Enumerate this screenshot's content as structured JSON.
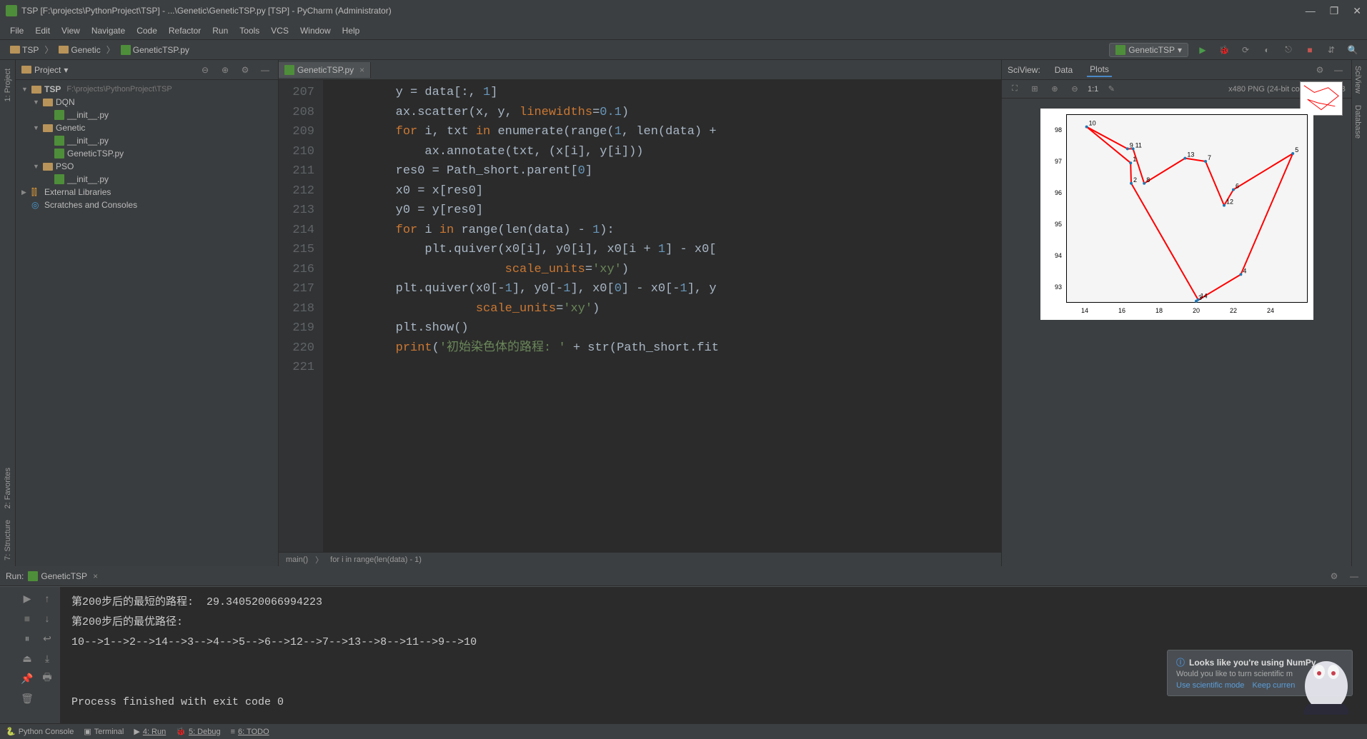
{
  "title": "TSP [F:\\projects\\PythonProject\\TSP] - ...\\Genetic\\GeneticTSP.py [TSP] - PyCharm (Administrator)",
  "menu": [
    "File",
    "Edit",
    "View",
    "Navigate",
    "Code",
    "Refactor",
    "Run",
    "Tools",
    "VCS",
    "Window",
    "Help"
  ],
  "breadcrumb": [
    "TSP",
    "Genetic",
    "GeneticTSP.py"
  ],
  "run_config": "GeneticTSP",
  "left_tabs": [
    "1: Project",
    "2: Favorites",
    "7: Structure"
  ],
  "right_tabs": [
    "SciView",
    "Database"
  ],
  "project": {
    "title": "Project",
    "root": {
      "name": "TSP",
      "path": "F:\\projects\\PythonProject\\TSP"
    },
    "dqn": {
      "name": "DQN",
      "init": "__init__.py"
    },
    "genetic": {
      "name": "Genetic",
      "init": "__init__.py",
      "file": "GeneticTSP.py"
    },
    "pso": {
      "name": "PSO",
      "init": "__init__.py"
    },
    "ext_lib": "External Libraries",
    "scratch": "Scratches and Consoles"
  },
  "editor": {
    "tab": "GeneticTSP.py",
    "start_line": 207,
    "lines": [
      "        y = data[:, 1]",
      "        ax.scatter(x, y, linewidths=0.1)",
      "        for i, txt in enumerate(range(1, len(data) +",
      "            ax.annotate(txt, (x[i], y[i]))",
      "        res0 = Path_short.parent[0]",
      "        x0 = x[res0]",
      "        y0 = y[res0]",
      "        for i in range(len(data) - 1):",
      "            plt.quiver(x0[i], y0[i], x0[i + 1] - x0[",
      "                       scale_units='xy')",
      "        plt.quiver(x0[-1], y0[-1], x0[0] - x0[-1], y",
      "                   scale_units='xy')",
      "        plt.show()",
      "        print('初始染色体的路程: ' + str(Path_short.fit",
      ""
    ],
    "crumb": [
      "main()",
      "for i in range(len(data) - 1)"
    ]
  },
  "sciview": {
    "title": "SciView:",
    "tabs": [
      "Data",
      "Plots"
    ],
    "ratio": "1:1",
    "info": "x480 PNG (24-bit color) 29.57 KB"
  },
  "chart_data": {
    "type": "scatter",
    "title": "",
    "xlabel": "",
    "ylabel": "",
    "xlim": [
      13,
      26
    ],
    "ylim": [
      92.5,
      98.5
    ],
    "xticks": [
      14,
      16,
      18,
      20,
      22,
      24
    ],
    "yticks": [
      93,
      94,
      95,
      96,
      97,
      98
    ],
    "points": [
      {
        "id": 1,
        "x": 16.47,
        "y": 96.95
      },
      {
        "id": 2,
        "x": 16.5,
        "y": 96.3
      },
      {
        "id": 3,
        "x": 20.0,
        "y": 92.55
      },
      {
        "id": 4,
        "x": 22.4,
        "y": 93.4
      },
      {
        "id": 5,
        "x": 25.2,
        "y": 97.25
      },
      {
        "id": 6,
        "x": 22.0,
        "y": 96.1
      },
      {
        "id": 7,
        "x": 20.5,
        "y": 97.0
      },
      {
        "id": 8,
        "x": 17.2,
        "y": 96.3
      },
      {
        "id": 9,
        "x": 16.3,
        "y": 97.4
      },
      {
        "id": 10,
        "x": 14.1,
        "y": 98.1
      },
      {
        "id": 11,
        "x": 16.6,
        "y": 97.4
      },
      {
        "id": 12,
        "x": 21.5,
        "y": 95.6
      },
      {
        "id": 13,
        "x": 19.4,
        "y": 97.1
      },
      {
        "id": 14,
        "x": 20.1,
        "y": 92.6
      }
    ],
    "path": [
      10,
      1,
      2,
      14,
      3,
      4,
      5,
      6,
      12,
      7,
      13,
      8,
      11,
      9,
      10
    ]
  },
  "run": {
    "title": "Run:",
    "tab": "GeneticTSP",
    "output": "第200步后的最短的路程:  29.340520066994223\n第200步后的最优路径:\n10-->1-->2-->14-->3-->4-->5-->6-->12-->7-->13-->8-->11-->9-->10\n\n\nProcess finished with exit code 0"
  },
  "notification": {
    "title": "Looks like you're using NumPy",
    "body": "Would you like to turn scientific m",
    "action1": "Use scientific mode",
    "action2": "Keep curren"
  },
  "bottom_tabs": [
    "Python Console",
    "Terminal",
    "4: Run",
    "5: Debug",
    "6: TODO"
  ]
}
